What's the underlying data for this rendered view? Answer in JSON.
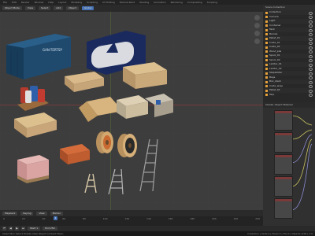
{
  "app": {
    "menu": [
      "File",
      "Edit",
      "Render",
      "Window",
      "Help",
      "Layout",
      "Modeling",
      "Sculpting",
      "UV Editing",
      "Texture Paint",
      "Shading",
      "Animation",
      "Rendering",
      "Compositing",
      "Scripting"
    ],
    "accent": "#4772b3"
  },
  "viewport": {
    "mode": "Object Mode",
    "menus": [
      "View",
      "Select",
      "Add",
      "Object"
    ],
    "shading": "Global",
    "container_label": "GAN-TERTSP"
  },
  "outliner": {
    "title": "Scene Collection",
    "rows": [
      "Collection",
      "Camera",
      "Light",
      "Container",
      "Tank",
      "Barrels",
      "Pallet_01",
      "Crate_01",
      "Crate_02",
      "Wood_pile",
      "Spool_01",
      "Spool_02",
      "Ladder_01",
      "Ladder_02",
      "Stepladder",
      "Bags",
      "Box_stack",
      "Crate_wrap",
      "Pallet_02",
      "Tarp"
    ]
  },
  "node_editor": {
    "title": "Shader",
    "object": "Object",
    "material": "Material"
  },
  "timeline": {
    "menus": [
      "Playback",
      "Keying",
      "View",
      "Marker"
    ],
    "frame": "1",
    "ticks": [
      "0",
      "20",
      "40",
      "60",
      "80",
      "100",
      "120",
      "140",
      "160",
      "180",
      "200",
      "220",
      "240"
    ],
    "start": "Start 1",
    "end": "End 250"
  },
  "status": {
    "left": "Select  Box Select  Rotate View  Object Context Menu",
    "right": "Collection | Verts 0 | Faces 0 | Tris 0 | Objects 0/18 | 3.0"
  }
}
